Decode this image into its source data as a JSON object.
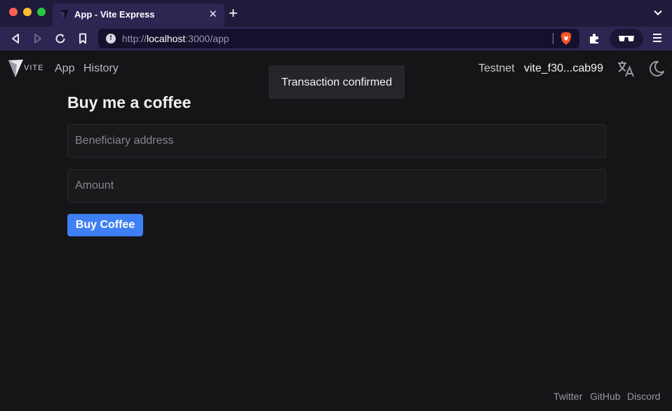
{
  "browser": {
    "tab_title": "App - Vite Express",
    "url_scheme": "http://",
    "url_host": "localhost",
    "url_rest": ":3000/app",
    "colors": {
      "tabstrip": "#1f1b3a",
      "toolbar": "#2d2653",
      "urlbar": "#13112b"
    }
  },
  "header": {
    "logo_text": "VITE",
    "nav": [
      {
        "label": "App"
      },
      {
        "label": "History"
      }
    ],
    "network": "Testnet",
    "address": "vite_f30...cab99",
    "icons": [
      "translate-icon",
      "moon-icon"
    ]
  },
  "toast": {
    "message": "Transaction confirmed"
  },
  "form": {
    "title": "Buy me a coffee",
    "beneficiary_placeholder": "Beneficiary address",
    "amount_placeholder": "Amount",
    "submit_label": "Buy Coffee",
    "accent_color": "#3f7ff4"
  },
  "footer": {
    "links": [
      {
        "label": "Twitter"
      },
      {
        "label": "GitHub"
      },
      {
        "label": "Discord"
      }
    ]
  }
}
